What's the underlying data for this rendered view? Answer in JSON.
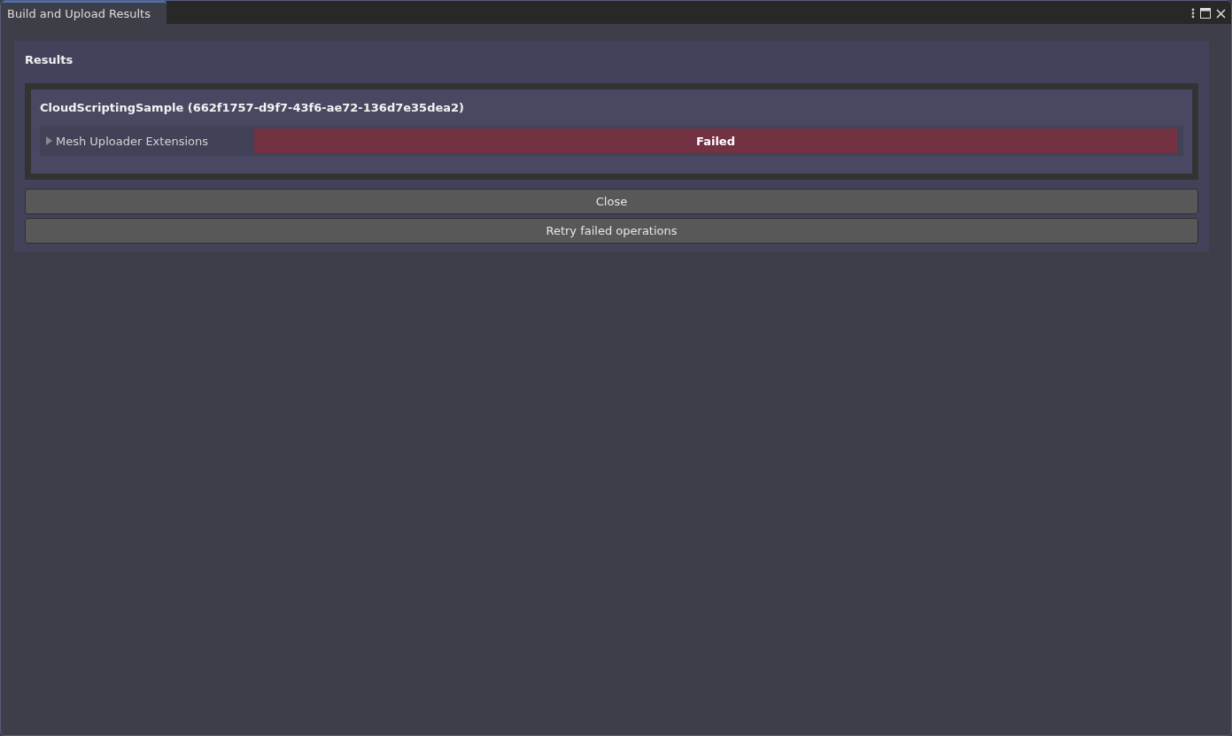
{
  "window": {
    "tab": {
      "label": "Build and Upload Results",
      "selected": true
    }
  },
  "results": {
    "title": "Results",
    "projects": [
      {
        "title": "CloudScriptingSample (662f1757-d9f7-43f6-ae72-136d7e35dea2)",
        "operations": [
          {
            "name": "Mesh Uploader Extensions",
            "expanded": false,
            "kind": "failed",
            "status_label": "Failed"
          }
        ]
      }
    ]
  },
  "buttons": [
    "Close",
    "Retry failed operations"
  ]
}
